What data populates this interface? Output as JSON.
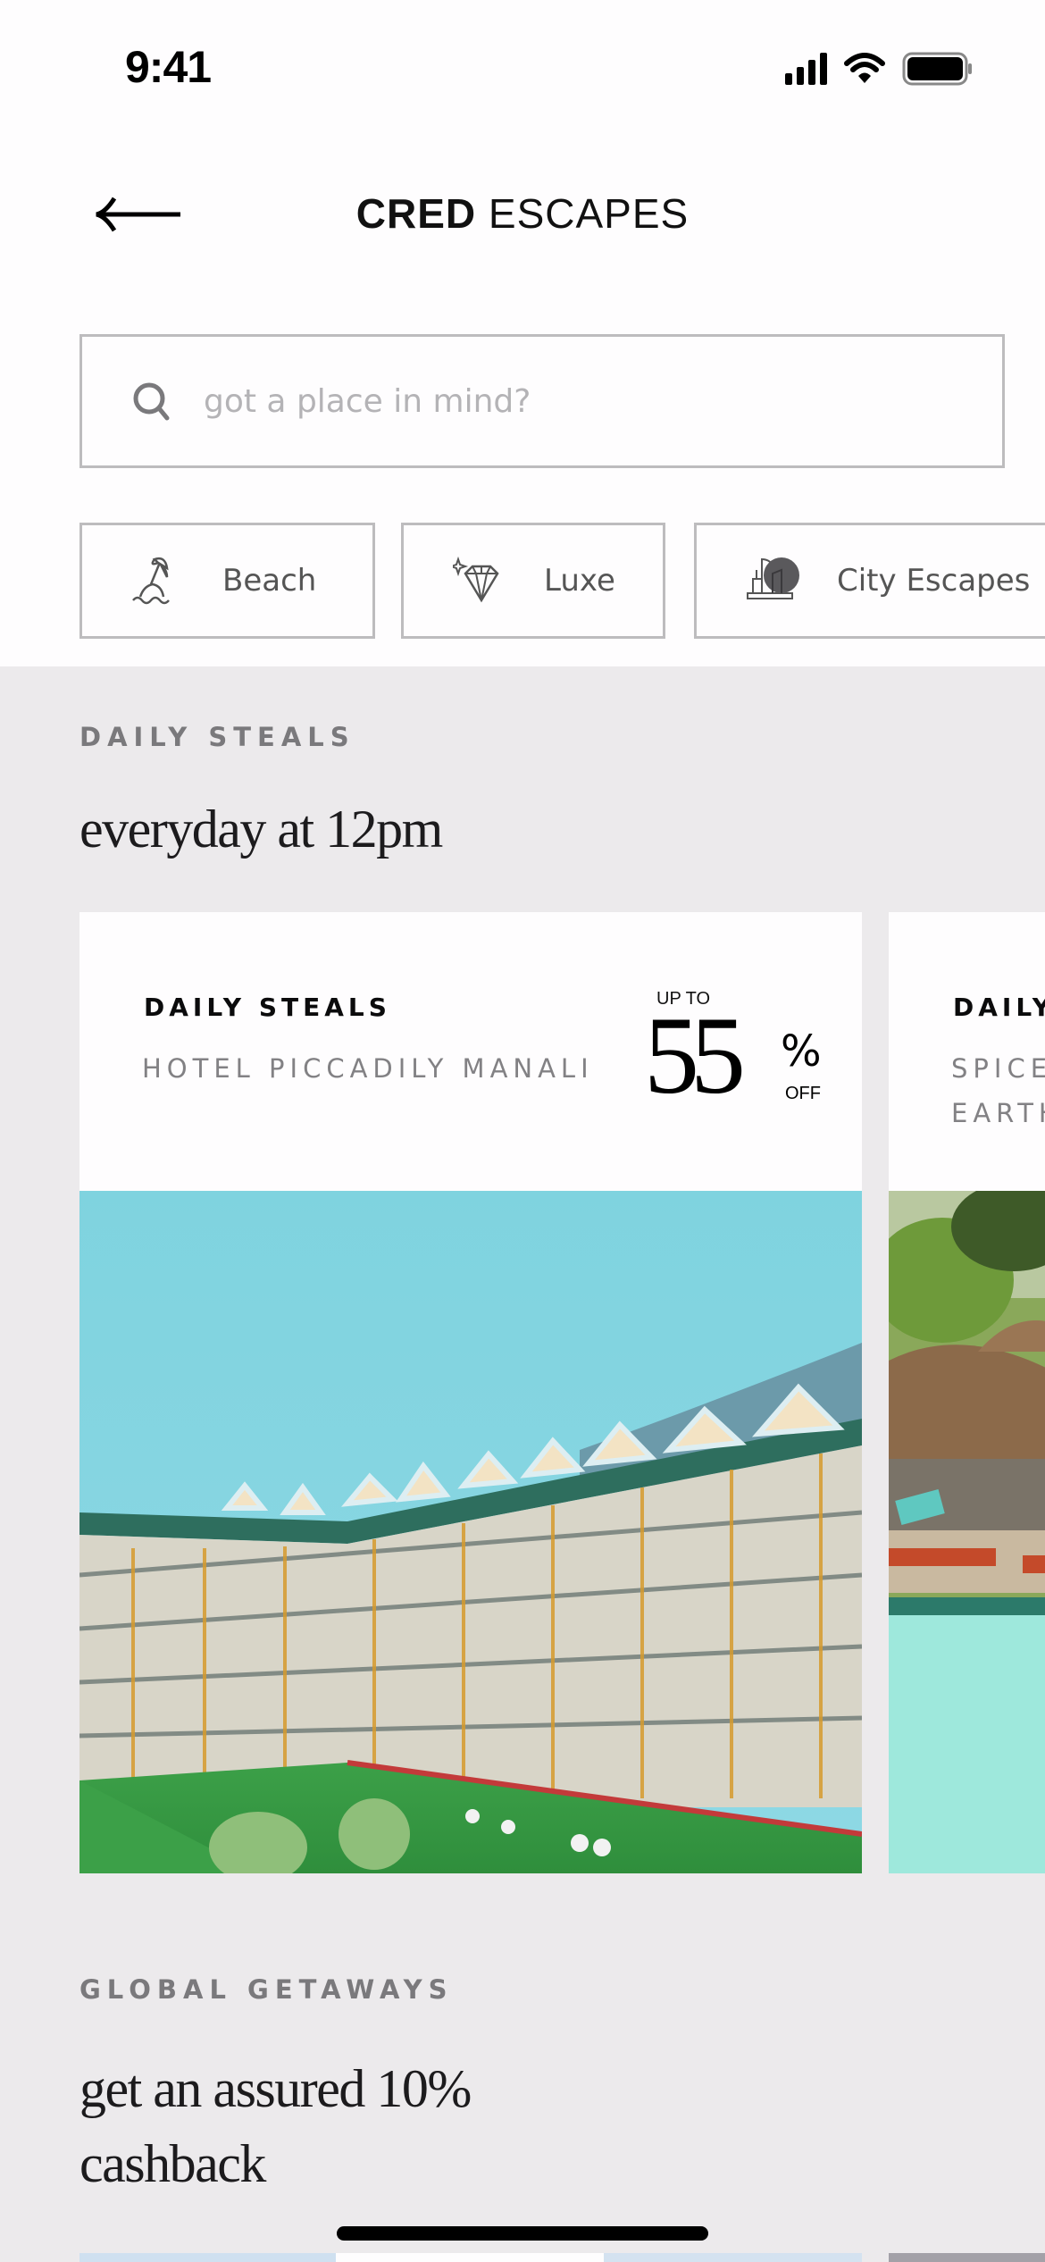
{
  "status_bar": {
    "time": "9:41",
    "signal_icon": "cellular-signal-icon",
    "wifi_icon": "wifi-icon",
    "battery_icon": "battery-icon"
  },
  "header": {
    "back_icon": "arrow-left-icon",
    "title_bold": "CRED",
    "title_light": " ESCAPES"
  },
  "search": {
    "icon": "search-icon",
    "value": "",
    "placeholder": "got a place in mind?"
  },
  "categories": [
    {
      "label": "Beach",
      "icon": "beach-umbrella-icon"
    },
    {
      "label": "Luxe",
      "icon": "diamond-icon"
    },
    {
      "label": "City Escapes",
      "icon": "city-buildings-icon"
    }
  ],
  "daily_steals": {
    "eyebrow": "DAILY STEALS",
    "headline": "everyday at 12pm",
    "cards": [
      {
        "kicker": "DAILY STEALS",
        "hotel": "HOTEL PICCADILY MANALI",
        "discount_prefix": "UP TO",
        "discount_value": "55",
        "discount_symbol": "%",
        "discount_suffix": "OFF",
        "image": "hotel-building-mountains-photo"
      },
      {
        "kicker": "DAILY STEALS",
        "hotel": "SPICE VILLAGE EARTH",
        "hotel_visible": "SPICE\nEARTH",
        "image": "resort-pool-photo"
      }
    ]
  },
  "global_getaways": {
    "eyebrow": "GLOBAL GETAWAYS",
    "headline_line1": "get an assured 10%",
    "headline_line2": "cashback"
  },
  "colors": {
    "page_bg": "#ECEAEC",
    "surface": "#FEFDFE",
    "border": "#BDBCBE",
    "eyebrow_text": "#7A797C",
    "headline_text": "#1C1B1D",
    "placeholder_text": "#B4B3B6"
  }
}
